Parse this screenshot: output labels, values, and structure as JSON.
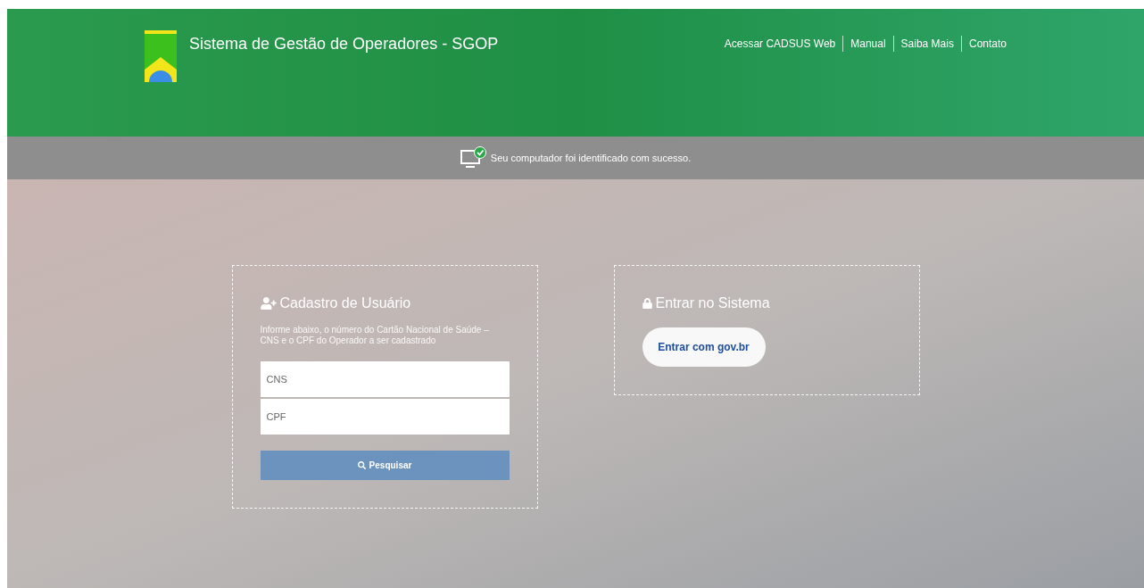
{
  "header": {
    "title": "Sistema de Gestão de Operadores - SGOP",
    "nav": [
      "Acessar CADSUS Web",
      "Manual",
      "Saiba Mais",
      "Contato"
    ]
  },
  "notice": {
    "text": "Seu computador foi identificado com sucesso."
  },
  "register_panel": {
    "title": "Cadastro de Usuário",
    "description": "Informe abaixo, o número do Cartão Nacional de Saúde – CNS e o CPF do Operador a ser cadastrado",
    "fields": [
      {
        "placeholder": "CNS"
      },
      {
        "placeholder": "CPF"
      }
    ],
    "button": "Pesquisar"
  },
  "login_panel": {
    "title": "Entrar no Sistema",
    "button": "Entrar com **gov.br**"
  }
}
